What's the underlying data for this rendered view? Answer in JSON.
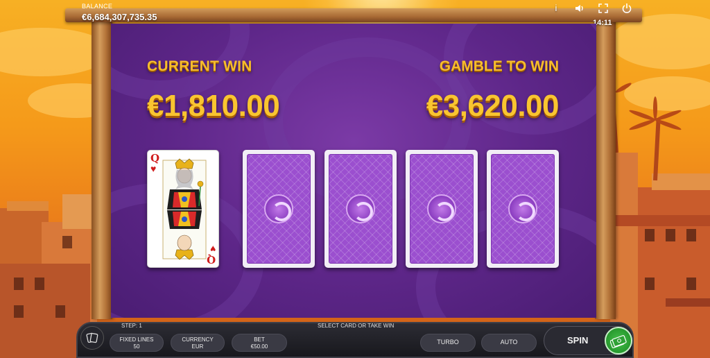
{
  "top_bar": {
    "balance_label": "BALANCE",
    "balance_value": "€6,684,307,735.35",
    "clock": "14:11",
    "icons": [
      "info-icon",
      "sound-icon",
      "fullscreen-icon",
      "power-icon"
    ]
  },
  "gamble": {
    "current_win_label": "CURRENT WIN",
    "current_win_value": "€1,810.00",
    "gamble_to_win_label": "GAMBLE TO WIN",
    "gamble_to_win_value": "€3,620.00",
    "dealer_card": {
      "rank": "Q",
      "suit": "♥",
      "suit_name": "hearts"
    },
    "face_down_cards": 4
  },
  "controls": {
    "step": "STEP: 1",
    "status": "SELECT CARD OR TAKE WIN",
    "fixed_lines_label": "FIXED LINES",
    "fixed_lines_value": "50",
    "currency_label": "CURRENCY",
    "currency_value": "EUR",
    "bet_label": "BET",
    "bet_value": "€50.00",
    "turbo": "TURBO",
    "auto": "AUTO",
    "spin": "SPIN"
  },
  "colors": {
    "gold_text": "#f9c530",
    "board_purple": "#5d2688",
    "card_back_purple": "#9b4fcf",
    "take_win_green": "#23932a"
  }
}
